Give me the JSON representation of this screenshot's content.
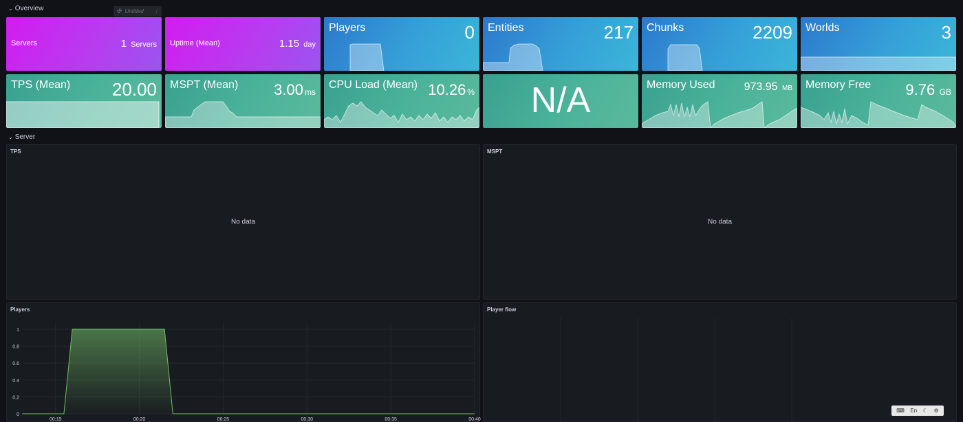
{
  "rows": {
    "overview": "Overview",
    "server": "Server"
  },
  "chip": {
    "label": "Untitled"
  },
  "stats": {
    "servers": {
      "title": "Servers",
      "value": "1",
      "unit": "Servers"
    },
    "uptime": {
      "title": "Uptime (Mean)",
      "value": "1.15",
      "unit": "day"
    },
    "players": {
      "title": "Players",
      "value": "0"
    },
    "entities": {
      "title": "Entities",
      "value": "217"
    },
    "chunks": {
      "title": "Chunks",
      "value": "2209"
    },
    "worlds": {
      "title": "Worlds",
      "value": "3"
    },
    "tps": {
      "title": "TPS (Mean)",
      "value": "20.00"
    },
    "mspt": {
      "title": "MSPT (Mean)",
      "value": "3.00",
      "unit": "ms"
    },
    "cpu": {
      "title": "CPU Load (Mean)",
      "value": "10.26",
      "unit": "%"
    },
    "na": {
      "value": "N/A"
    },
    "memused": {
      "title": "Memory Used",
      "value": "973.95",
      "unit": "MB"
    },
    "memfree": {
      "title": "Memory Free",
      "value": "9.76",
      "unit": "GB"
    }
  },
  "panels": {
    "tps": {
      "title": "TPS",
      "empty": "No data"
    },
    "mspt": {
      "title": "MSPT",
      "empty": "No data"
    },
    "players": {
      "title": "Players"
    },
    "playerflow": {
      "title": "Player flow"
    }
  },
  "chart_data": {
    "type": "area",
    "x": [
      "00:13",
      "00:14",
      "00:15",
      "00:15.5",
      "00:16",
      "00:21",
      "00:21.5",
      "00:22",
      "00:25",
      "00:30",
      "00:35",
      "00:40"
    ],
    "values": [
      0,
      0,
      0,
      0,
      1,
      1,
      1,
      0,
      0,
      0,
      0,
      0
    ],
    "xticks": [
      "00:15",
      "00:20",
      "00:25",
      "00:30",
      "00:35",
      "00:40"
    ],
    "yticks": [
      "0",
      "0.2",
      "0.4",
      "0.6",
      "0.8",
      "1"
    ],
    "ylim": [
      0,
      1
    ],
    "color": "#73bf69",
    "grid": true
  },
  "keyboard": {
    "lang": "En"
  },
  "colors": {
    "bg": "#111217",
    "panel": "#181b1f",
    "line": "#73bf69"
  }
}
